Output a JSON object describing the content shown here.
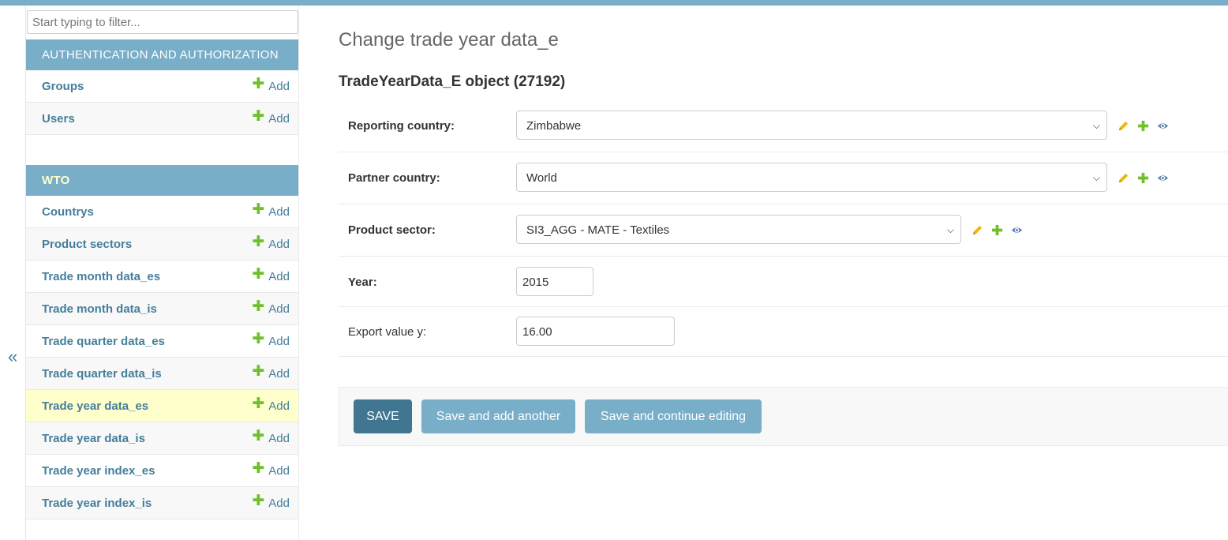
{
  "sidebar": {
    "collapse_glyph": "«",
    "filter_placeholder": "Start typing to filter...",
    "modules": [
      {
        "caption": "AUTHENTICATION AND AUTHORIZATION",
        "models": [
          {
            "name": "Groups",
            "add_label": "Add"
          },
          {
            "name": "Users",
            "add_label": "Add"
          }
        ]
      },
      {
        "caption": "WTO",
        "models": [
          {
            "name": "Countrys",
            "add_label": "Add"
          },
          {
            "name": "Product sectors",
            "add_label": "Add"
          },
          {
            "name": "Trade month data_es",
            "add_label": "Add"
          },
          {
            "name": "Trade month data_is",
            "add_label": "Add"
          },
          {
            "name": "Trade quarter data_es",
            "add_label": "Add"
          },
          {
            "name": "Trade quarter data_is",
            "add_label": "Add"
          },
          {
            "name": "Trade year data_es",
            "add_label": "Add",
            "current": true
          },
          {
            "name": "Trade year data_is",
            "add_label": "Add"
          },
          {
            "name": "Trade year index_es",
            "add_label": "Add"
          },
          {
            "name": "Trade year index_is",
            "add_label": "Add"
          }
        ]
      }
    ]
  },
  "main": {
    "page_title": "Change trade year data_e",
    "object_heading": "TradeYearData_E object (27192)",
    "fields": {
      "reporting_country": {
        "label": "Reporting country:",
        "value": "Zimbabwe"
      },
      "partner_country": {
        "label": "Partner country:",
        "value": "World"
      },
      "product_sector": {
        "label": "Product sector:",
        "value": "SI3_AGG - MATE - Textiles"
      },
      "year": {
        "label": "Year:",
        "value": "2015"
      },
      "export_value_y": {
        "label": "Export value y:",
        "value": "16.00"
      }
    },
    "buttons": {
      "save": "SAVE",
      "save_add_another": "Save and add another",
      "save_continue": "Save and continue editing"
    }
  },
  "colors": {
    "header_blue": "#79aec8",
    "link_blue": "#447e9b",
    "save_button": "#417690",
    "add_green": "#70bf2b",
    "change_pencil": "#efb80b",
    "current_row_highlight": "#ffffcc"
  },
  "icons": {
    "add": "plus-icon",
    "change": "pencil-icon",
    "view": "eye-icon",
    "collapse": "double-chevron-left-icon"
  }
}
